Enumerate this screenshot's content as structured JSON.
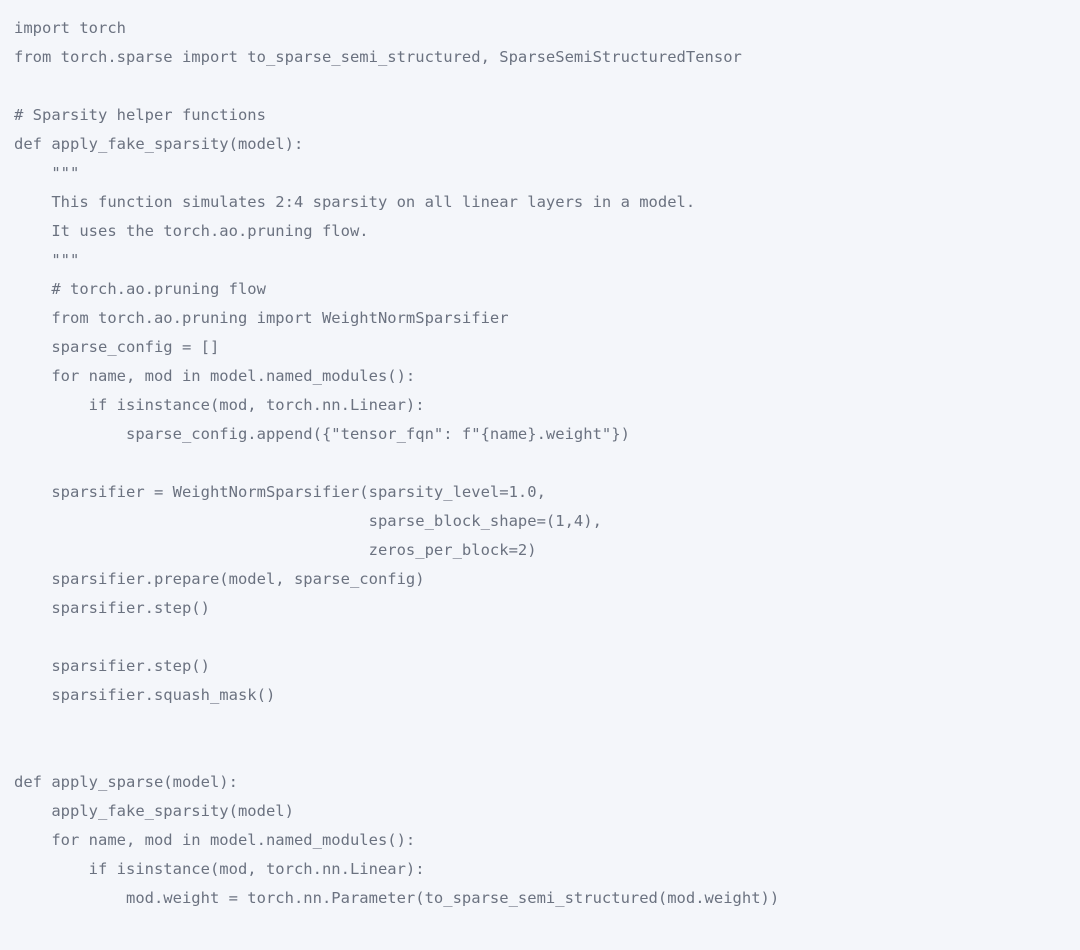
{
  "code": {
    "lines": [
      "import torch",
      "from torch.sparse import to_sparse_semi_structured, SparseSemiStructuredTensor",
      "",
      "# Sparsity helper functions",
      "def apply_fake_sparsity(model):",
      "    \"\"\"",
      "    This function simulates 2:4 sparsity on all linear layers in a model.",
      "    It uses the torch.ao.pruning flow.",
      "    \"\"\"",
      "    # torch.ao.pruning flow",
      "    from torch.ao.pruning import WeightNormSparsifier",
      "    sparse_config = []",
      "    for name, mod in model.named_modules():",
      "        if isinstance(mod, torch.nn.Linear):",
      "            sparse_config.append({\"tensor_fqn\": f\"{name}.weight\"})",
      "",
      "    sparsifier = WeightNormSparsifier(sparsity_level=1.0,",
      "                                      sparse_block_shape=(1,4),",
      "                                      zeros_per_block=2)",
      "    sparsifier.prepare(model, sparse_config)",
      "    sparsifier.step()",
      "",
      "    sparsifier.step()",
      "    sparsifier.squash_mask()",
      "",
      "",
      "def apply_sparse(model):",
      "    apply_fake_sparsity(model)",
      "    for name, mod in model.named_modules():",
      "        if isinstance(mod, torch.nn.Linear):",
      "            mod.weight = torch.nn.Parameter(to_sparse_semi_structured(mod.weight))"
    ]
  }
}
